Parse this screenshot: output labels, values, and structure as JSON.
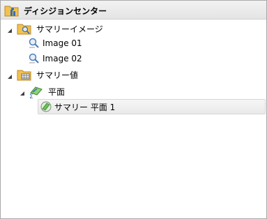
{
  "header": {
    "title": "ディシジョンセンター",
    "icon": "decision-center-folder-icon"
  },
  "tree": {
    "summary_image": {
      "label": "サマリーイメージ",
      "icon": "summary-image-folder-icon",
      "children": [
        {
          "label": "Image 01",
          "icon": "image-magnifier-icon"
        },
        {
          "label": "Image 02",
          "icon": "image-magnifier-icon"
        }
      ]
    },
    "summary_value": {
      "label": "サマリー値",
      "icon": "summary-value-folder-icon",
      "plane": {
        "label": "平面",
        "icon": "sum-plane-icon",
        "children": [
          {
            "label": "サマリー 平面 1",
            "icon": "plane-icon",
            "selected": true
          }
        ]
      }
    }
  },
  "colors": {
    "folder": "#f2c14e",
    "plane_green": "#4a9a3a",
    "selection": "#ececec"
  }
}
